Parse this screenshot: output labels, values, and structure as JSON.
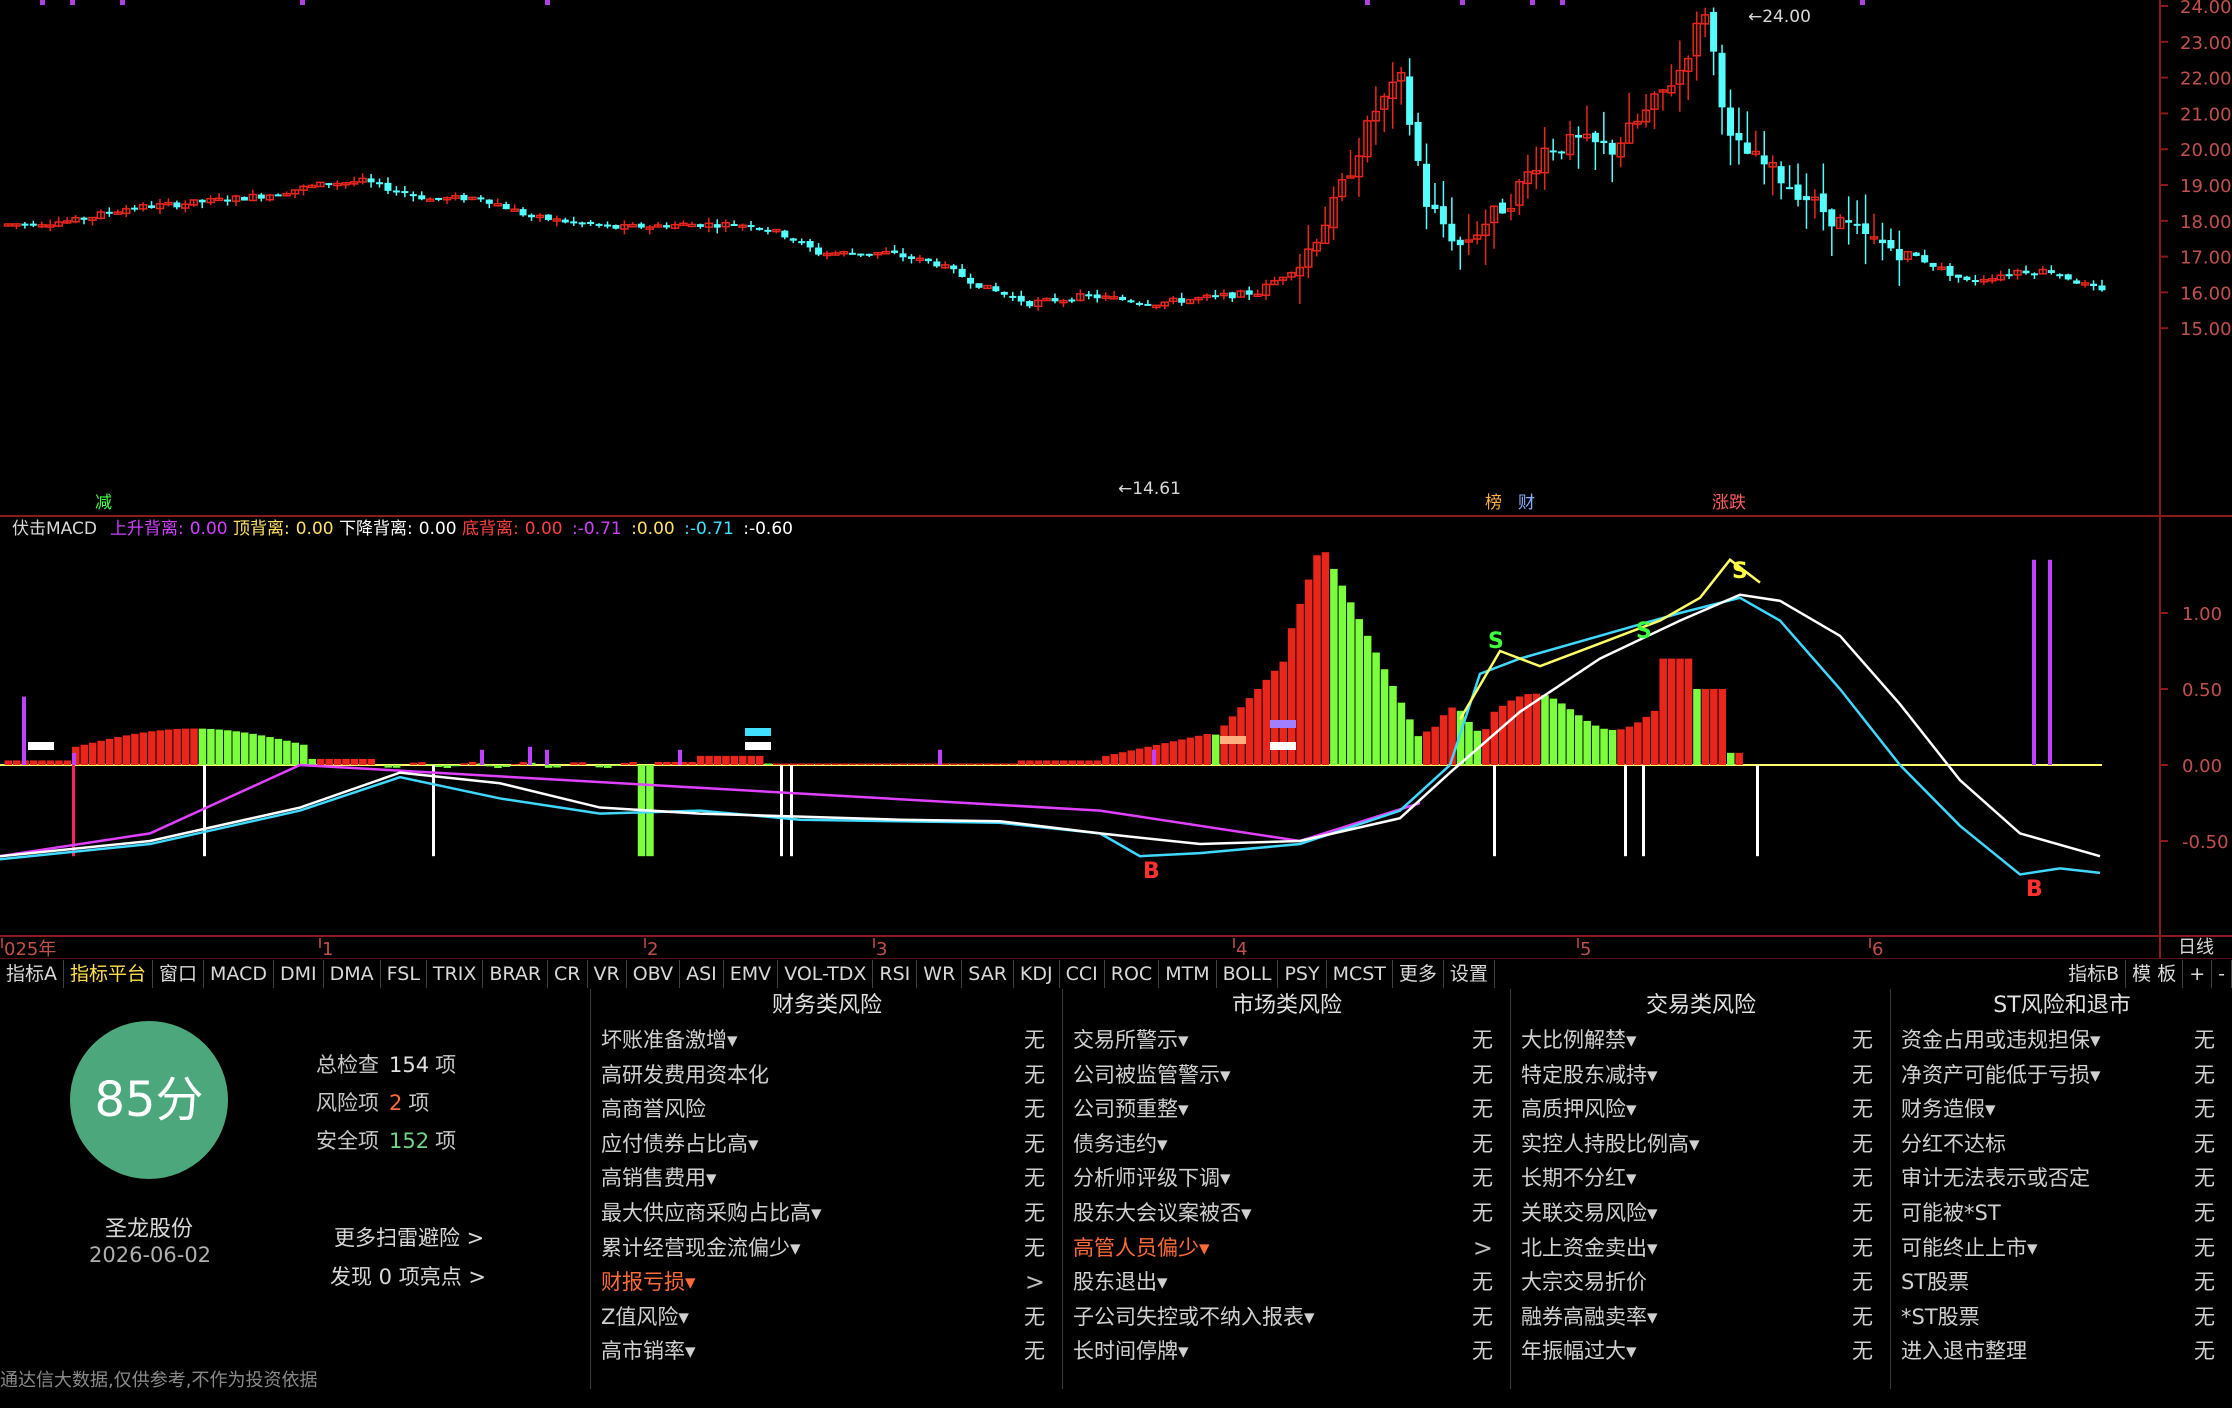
{
  "price_axis": [
    "24.00",
    "23.00",
    "22.00",
    "21.00",
    "20.00",
    "19.00",
    "18.00",
    "17.00",
    "16.00",
    "15.00"
  ],
  "price_labels": {
    "high": "24.00",
    "low": "14.61"
  },
  "event_markers": [
    "减",
    "榜",
    "财",
    "涨跌"
  ],
  "macd_header": {
    "name": "伏击MACD",
    "items": [
      {
        "label": "上升背离:",
        "value": "0.00",
        "color": "#d040ff"
      },
      {
        "label": "顶背离:",
        "value": "0.00",
        "color": "#ffe066"
      },
      {
        "label": "下降背离:",
        "value": "0.00",
        "color": "#ffffff"
      },
      {
        "label": "底背离:",
        "value": "0.00",
        "color": "#ff4040"
      }
    ],
    "values": [
      {
        "text": "-0.71",
        "color": "#d040ff"
      },
      {
        "text": "0.00",
        "color": "#ffe066"
      },
      {
        "text": "-0.71",
        "color": "#40e0ff"
      },
      {
        "text": "-0.60",
        "color": "#ffffff"
      }
    ]
  },
  "macd_axis": [
    "1.00",
    "0.50",
    "0.00",
    "-0.50"
  ],
  "macd_signals": [
    "S",
    "S",
    "S",
    "B",
    "B"
  ],
  "time_axis": [
    "025年",
    "1",
    "2",
    "3",
    "4",
    "5",
    "6"
  ],
  "period_label": "日线",
  "tabs": [
    "指标A",
    "指标平台",
    "窗口",
    "MACD",
    "DMI",
    "DMA",
    "FSL",
    "TRIX",
    "BRAR",
    "CR",
    "VR",
    "OBV",
    "ASI",
    "EMV",
    "VOL-TDX",
    "RSI",
    "WR",
    "SAR",
    "KDJ",
    "CCI",
    "ROC",
    "MTM",
    "BOLL",
    "PSY",
    "MCST",
    "更多",
    "设置"
  ],
  "tabs_right": [
    "指标B",
    "模 板",
    "+",
    "-"
  ],
  "score": {
    "value": "85分",
    "total_label": "总检查",
    "total_value": "154",
    "unit": "项",
    "risk_label": "风险项",
    "risk_value": "2",
    "safe_label": "安全项",
    "safe_value": "152",
    "stock_name": "圣龙股份",
    "date": "2026-06-02",
    "more_link": "更多扫雷避险 >",
    "highlights_link": "发现 0 项亮点 >"
  },
  "disclaimer": "通达信大数据,仅供参考,不作为投资依据",
  "risk_columns": [
    {
      "title": "财务类风险",
      "rows": [
        {
          "label": "坏账准备激增▾",
          "value": "无"
        },
        {
          "label": "高研发费用资本化",
          "value": "无"
        },
        {
          "label": "高商誉风险",
          "value": "无"
        },
        {
          "label": "应付债券占比高▾",
          "value": "无"
        },
        {
          "label": "高销售费用▾",
          "value": "无"
        },
        {
          "label": "最大供应商采购占比高▾",
          "value": "无"
        },
        {
          "label": "累计经营现金流偏少▾",
          "value": "无"
        },
        {
          "label": "财报亏损▾",
          "value": ">",
          "warn": true
        },
        {
          "label": "Z值风险▾",
          "value": "无"
        },
        {
          "label": "高市销率▾",
          "value": "无"
        }
      ]
    },
    {
      "title": "市场类风险",
      "rows": [
        {
          "label": "交易所警示▾",
          "value": "无"
        },
        {
          "label": "公司被监管警示▾",
          "value": "无"
        },
        {
          "label": "公司预重整▾",
          "value": "无"
        },
        {
          "label": "债务违约▾",
          "value": "无"
        },
        {
          "label": "分析师评级下调▾",
          "value": "无"
        },
        {
          "label": "股东大会议案被否▾",
          "value": "无"
        },
        {
          "label": "高管人员偏少▾",
          "value": ">",
          "warn": true
        },
        {
          "label": "股东退出▾",
          "value": "无"
        },
        {
          "label": "子公司失控或不纳入报表▾",
          "value": "无"
        },
        {
          "label": "长时间停牌▾",
          "value": "无"
        }
      ]
    },
    {
      "title": "交易类风险",
      "rows": [
        {
          "label": "大比例解禁▾",
          "value": "无"
        },
        {
          "label": "特定股东减持▾",
          "value": "无"
        },
        {
          "label": "高质押风险▾",
          "value": "无"
        },
        {
          "label": "实控人持股比例高▾",
          "value": "无"
        },
        {
          "label": "长期不分红▾",
          "value": "无"
        },
        {
          "label": "关联交易风险▾",
          "value": "无"
        },
        {
          "label": "北上资金卖出▾",
          "value": "无"
        },
        {
          "label": "大宗交易折价",
          "value": "无"
        },
        {
          "label": "融券高融卖率▾",
          "value": "无"
        },
        {
          "label": "年振幅过大▾",
          "value": "无"
        }
      ]
    },
    {
      "title": "ST风险和退市",
      "rows": [
        {
          "label": "资金占用或违规担保▾",
          "value": "无"
        },
        {
          "label": "净资产可能低于亏损▾",
          "value": "无"
        },
        {
          "label": "财务造假▾",
          "value": "无"
        },
        {
          "label": "分红不达标",
          "value": "无"
        },
        {
          "label": "审计无法表示或否定",
          "value": "无"
        },
        {
          "label": "可能被*ST",
          "value": "无"
        },
        {
          "label": "可能终止上市▾",
          "value": "无"
        },
        {
          "label": "ST股票",
          "value": "无"
        },
        {
          "label": "*ST股票",
          "value": "无"
        },
        {
          "label": "进入退市整理",
          "value": "无"
        }
      ]
    }
  ],
  "colors": {
    "up": "#e8261c",
    "down": "#54ffff",
    "macd_pos": "#e8261c",
    "macd_neg": "#7cff3c",
    "grid_border": "#8b1a1a",
    "score": "#4ca87c",
    "warn": "#ff6a3a"
  }
}
